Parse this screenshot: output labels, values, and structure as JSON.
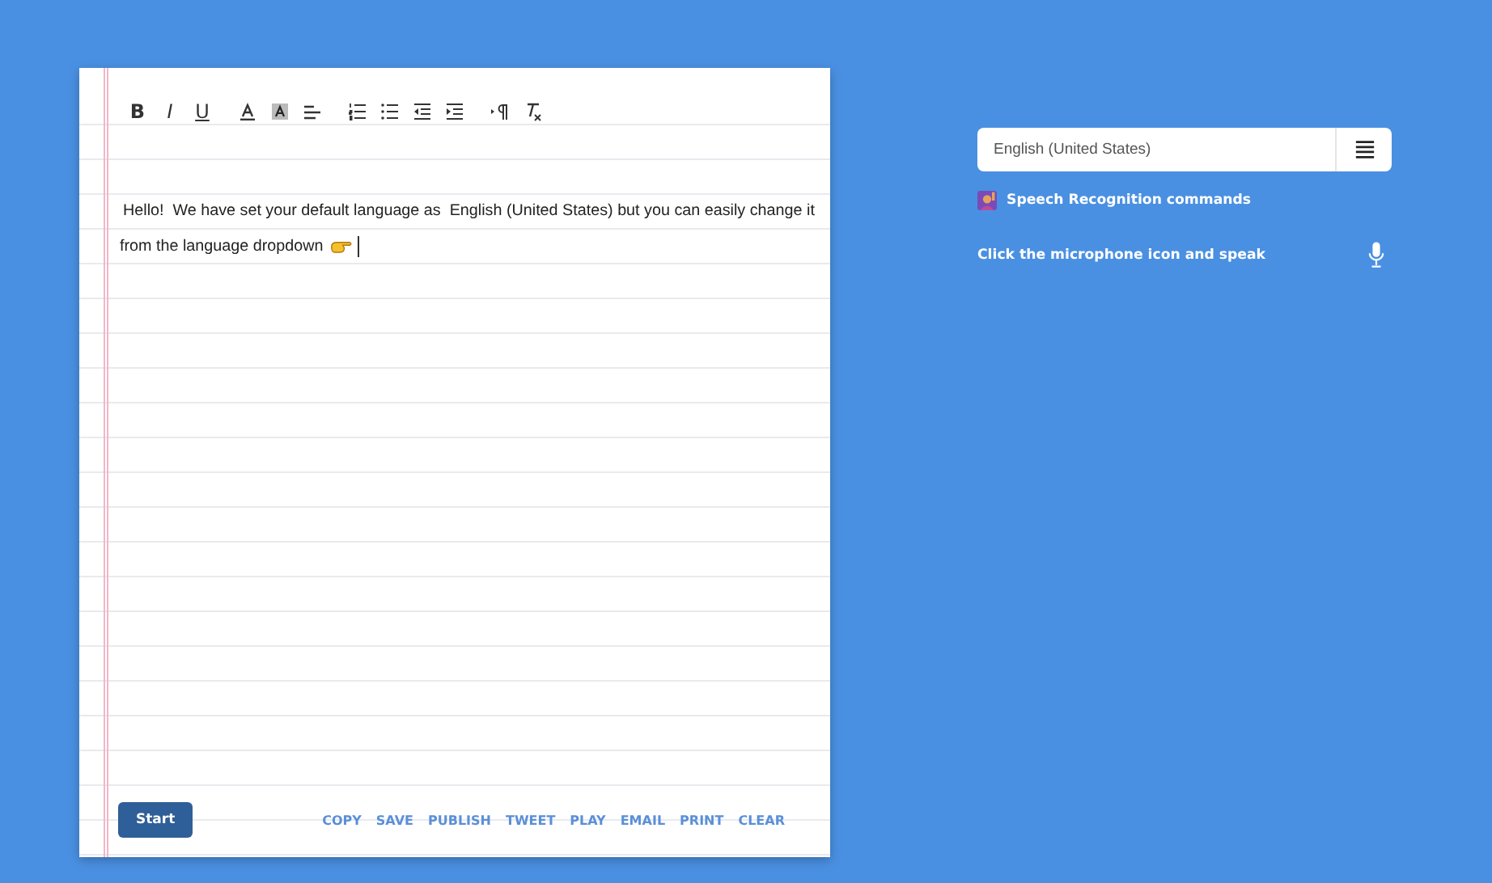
{
  "toolbar": [
    {
      "kind": "bold",
      "label": "B"
    },
    {
      "kind": "italic",
      "label": "I"
    },
    {
      "kind": "underline",
      "label": "U"
    },
    {
      "kind": "text-color"
    },
    {
      "kind": "highlight"
    },
    {
      "kind": "align"
    },
    {
      "kind": "ordered-list"
    },
    {
      "kind": "bullet-list"
    },
    {
      "kind": "outdent"
    },
    {
      "kind": "indent"
    },
    {
      "kind": "paragraph-direction"
    },
    {
      "kind": "clear-format"
    }
  ],
  "editor": {
    "lines": [
      "Hello!  We have set your default language as  English (United States) but you can easily change it",
      "from the language dropdown"
    ]
  },
  "start_button": "Start",
  "actions": [
    "COPY",
    "SAVE",
    "PUBLISH",
    "TWEET",
    "PLAY",
    "EMAIL",
    "PRINT",
    "CLEAR"
  ],
  "language_select": {
    "value": "English (United States)"
  },
  "commands_link": "Speech Recognition commands",
  "mic_hint": "Click the microphone icon and speak"
}
